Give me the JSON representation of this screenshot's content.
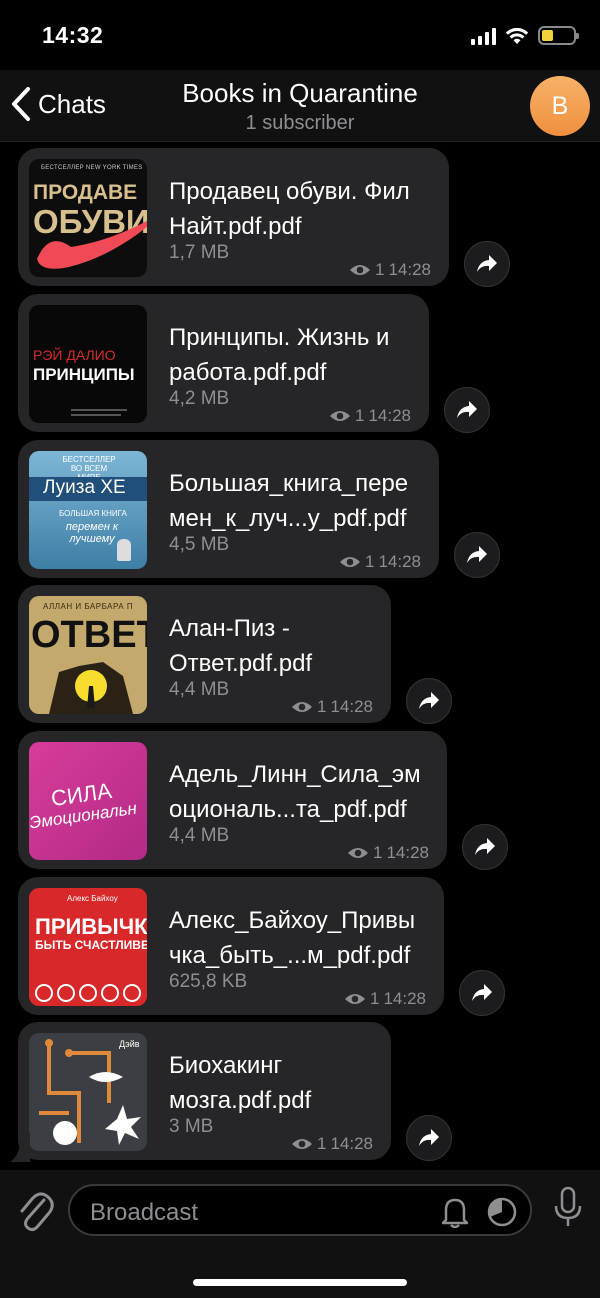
{
  "status": {
    "time": "14:32"
  },
  "nav": {
    "back_label": "Chats",
    "title": "Books in Quarantine",
    "subtitle": "1 subscriber",
    "avatar_letter": "B"
  },
  "messages": [
    {
      "line1": "Продавец обуви. Фил",
      "line2": "Найт.pdf.pdf",
      "size": "1,7 MB",
      "views": "1",
      "time": "14:28",
      "cover": {
        "top": "БЕСТСЕЛЛЕР NEW YORK TIMES",
        "l1": "ПРОДАВЕ",
        "l2": "ОБУВИ"
      }
    },
    {
      "line1": "Принципы. Жизнь и",
      "line2": "работа.pdf.pdf",
      "size": "4,2 MB",
      "views": "1",
      "time": "14:28",
      "cover": {
        "l1": "РЭЙ ДАЛИО",
        "l2": "ПРИНЦИПЫ"
      }
    },
    {
      "line1": "Большая_книга_пере",
      "line2": "мен_к_луч...у_pdf.pdf",
      "size": "4,5 MB",
      "views": "1",
      "time": "14:28",
      "cover": {
        "top": "БЕСТСЕЛЛЕР ВО ВСЕМ МИРЕ",
        "l1": "Луиза ХЕ",
        "l2": "БОЛЬШАЯ КНИГА",
        "l3": "перемен к лучшему"
      }
    },
    {
      "line1": "Алан-Пиз -",
      "line2": "Ответ.pdf.pdf",
      "size": "4,4 MB",
      "views": "1",
      "time": "14:28",
      "cover": {
        "top": "АЛЛАН И БАРБАРА П",
        "l1": "ОТВЕТ"
      }
    },
    {
      "line1": "Адель_Линн_Сила_эм",
      "line2": "оциональ...та_pdf.pdf",
      "size": "4,4 MB",
      "views": "1",
      "time": "14:28",
      "cover": {
        "l1": "СИЛА",
        "l2": "Эмоциональн"
      }
    },
    {
      "line1": "Алекс_Байхоу_Привы",
      "line2": "чка_быть_...м_pdf.pdf",
      "size": "625,8 KB",
      "views": "1",
      "time": "14:28",
      "cover": {
        "top": "Алекс Байхоу",
        "l1": "ПРИВЫЧКА",
        "l2": "БЫТЬ СЧАСТЛИВЕ"
      }
    },
    {
      "line1": "Биохакинг",
      "line2": "мозга.pdf.pdf",
      "size": "3 MB",
      "views": "1",
      "time": "14:28",
      "cover": {
        "top": "Дэйв"
      }
    }
  ],
  "input": {
    "placeholder": "Broadcast"
  },
  "colors": {
    "bubble": "#262628",
    "accent": "#f0913f",
    "meta": "#8e8e93"
  }
}
